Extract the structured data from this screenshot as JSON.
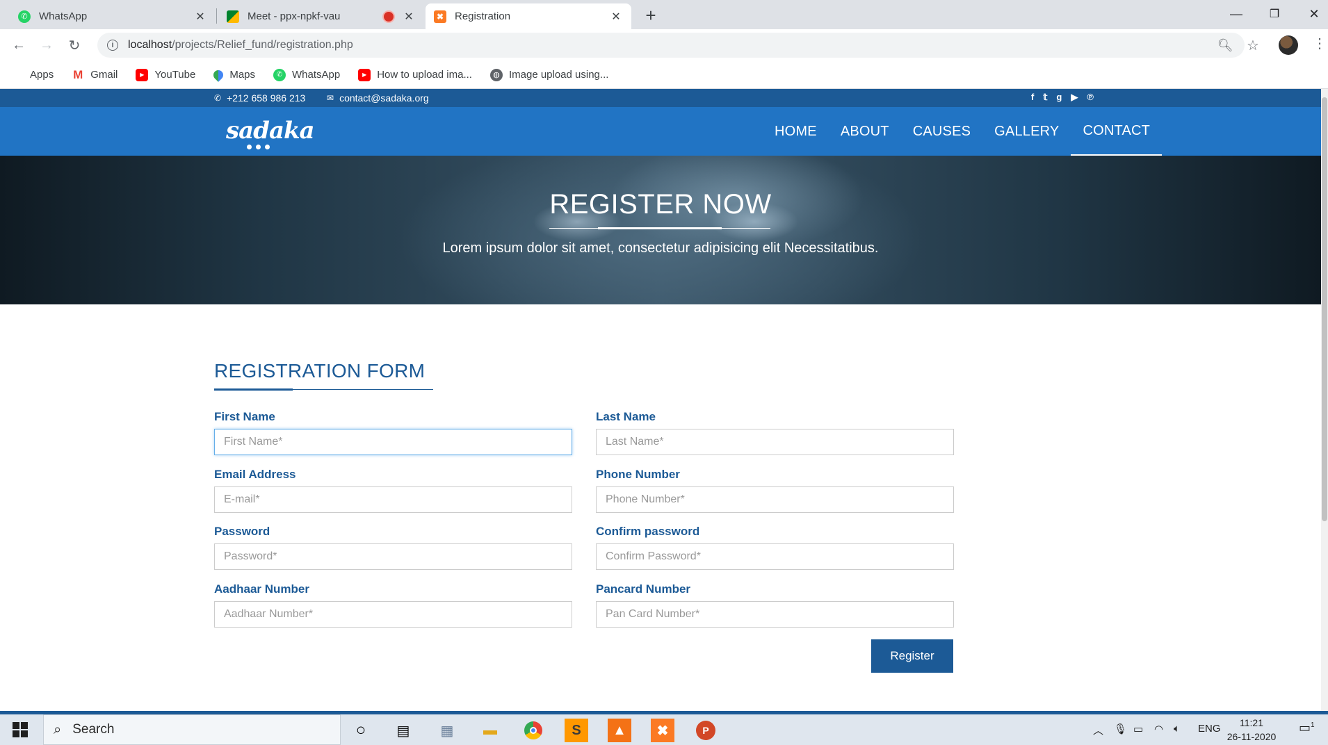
{
  "browser": {
    "tabs": [
      {
        "title": "WhatsApp",
        "favicon": "whatsapp-icon"
      },
      {
        "title": "Meet - ppx-npkf-vau",
        "favicon": "google-meet-icon"
      },
      {
        "title": "Registration",
        "favicon": "xampp-icon"
      }
    ],
    "url_host": "localhost",
    "url_path": "/projects/Relief_fund/registration.php",
    "bookmarks": [
      {
        "label": "Apps",
        "icon": "apps-grid-icon"
      },
      {
        "label": "Gmail",
        "icon": "gmail-icon"
      },
      {
        "label": "YouTube",
        "icon": "youtube-icon"
      },
      {
        "label": "Maps",
        "icon": "maps-icon"
      },
      {
        "label": "WhatsApp",
        "icon": "whatsapp-icon"
      },
      {
        "label": "How to upload ima...",
        "icon": "youtube-icon"
      },
      {
        "label": "Image upload using...",
        "icon": "globe-icon"
      }
    ]
  },
  "site": {
    "topbar": {
      "phone": "+212 658 986 213",
      "email": "contact@sadaka.org"
    },
    "logo": "sadaka",
    "nav": [
      "HOME",
      "ABOUT",
      "CAUSES",
      "GALLERY",
      "CONTACT"
    ],
    "hero": {
      "title": "REGISTER NOW",
      "subtitle": "Lorem ipsum dolor sit amet, consectetur adipisicing elit Necessitatibus."
    },
    "form": {
      "title": "REGISTRATION FORM",
      "fields": [
        {
          "label": "First Name",
          "placeholder": "First Name*"
        },
        {
          "label": "Last Name",
          "placeholder": "Last Name*"
        },
        {
          "label": "Email Address",
          "placeholder": "E-mail*"
        },
        {
          "label": "Phone Number",
          "placeholder": "Phone Number*"
        },
        {
          "label": "Password",
          "placeholder": "Password*"
        },
        {
          "label": "Confirm password",
          "placeholder": "Confirm Password*"
        },
        {
          "label": "Aadhaar Number",
          "placeholder": "Aadhaar Number*"
        },
        {
          "label": "Pancard Number",
          "placeholder": "Pan Card Number*"
        }
      ],
      "submit_label": "Register"
    }
  },
  "taskbar": {
    "search_placeholder": "Search",
    "language": "ENG",
    "time": "11:21",
    "date": "26-11-2020",
    "notification_count": "1"
  },
  "colors": {
    "brand_dark": "#1c5a96",
    "brand": "#2174c4"
  }
}
